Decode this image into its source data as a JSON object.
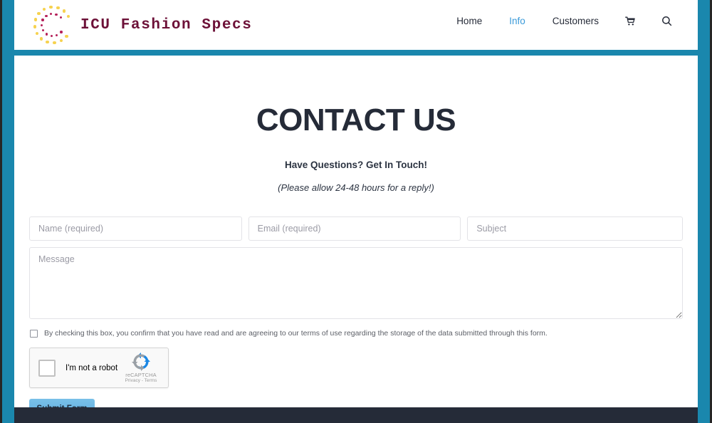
{
  "site": {
    "brand_title": "ICU Fashion Specs",
    "logo_icon": "dotted-circle-logo",
    "logo_outer_color": "#f6d24f",
    "logo_inner_color": "#b5215a",
    "brand_color": "#6d1138",
    "frame_color": "#1a87ad",
    "footer_color": "#252b38"
  },
  "nav": {
    "items": [
      {
        "label": "Home",
        "active": false,
        "name": "nav-link-home"
      },
      {
        "label": "Info",
        "active": true,
        "name": "nav-link-info"
      },
      {
        "label": "Customers",
        "active": false,
        "name": "nav-link-customers"
      }
    ],
    "cart_icon": "shopping-cart-icon",
    "search_icon": "search-icon",
    "active_color": "#3a9ad9"
  },
  "page": {
    "title": "CONTACT US",
    "subhead": "Have Questions? Get In Touch!",
    "subnote": "(Please allow 24-48 hours for a reply!)"
  },
  "form": {
    "name_value": "",
    "name_placeholder": "Name (required)",
    "email_value": "",
    "email_placeholder": "Email (required)",
    "subject_value": "",
    "subject_placeholder": "Subject",
    "message_value": "",
    "message_placeholder": "Message",
    "consent_text": "By checking this box, you confirm that you have read and are agreeing to our terms of use regarding the storage of the data submitted through this form.",
    "consent_checked": false,
    "submit_label": "Submit Form",
    "submit_color": "#5eade0"
  },
  "recaptcha": {
    "label": "I'm not a robot",
    "brand_name": "reCAPTCHA",
    "legal": "Privacy - Terms",
    "checked": false,
    "logo_icon": "recaptcha-logo-icon"
  }
}
